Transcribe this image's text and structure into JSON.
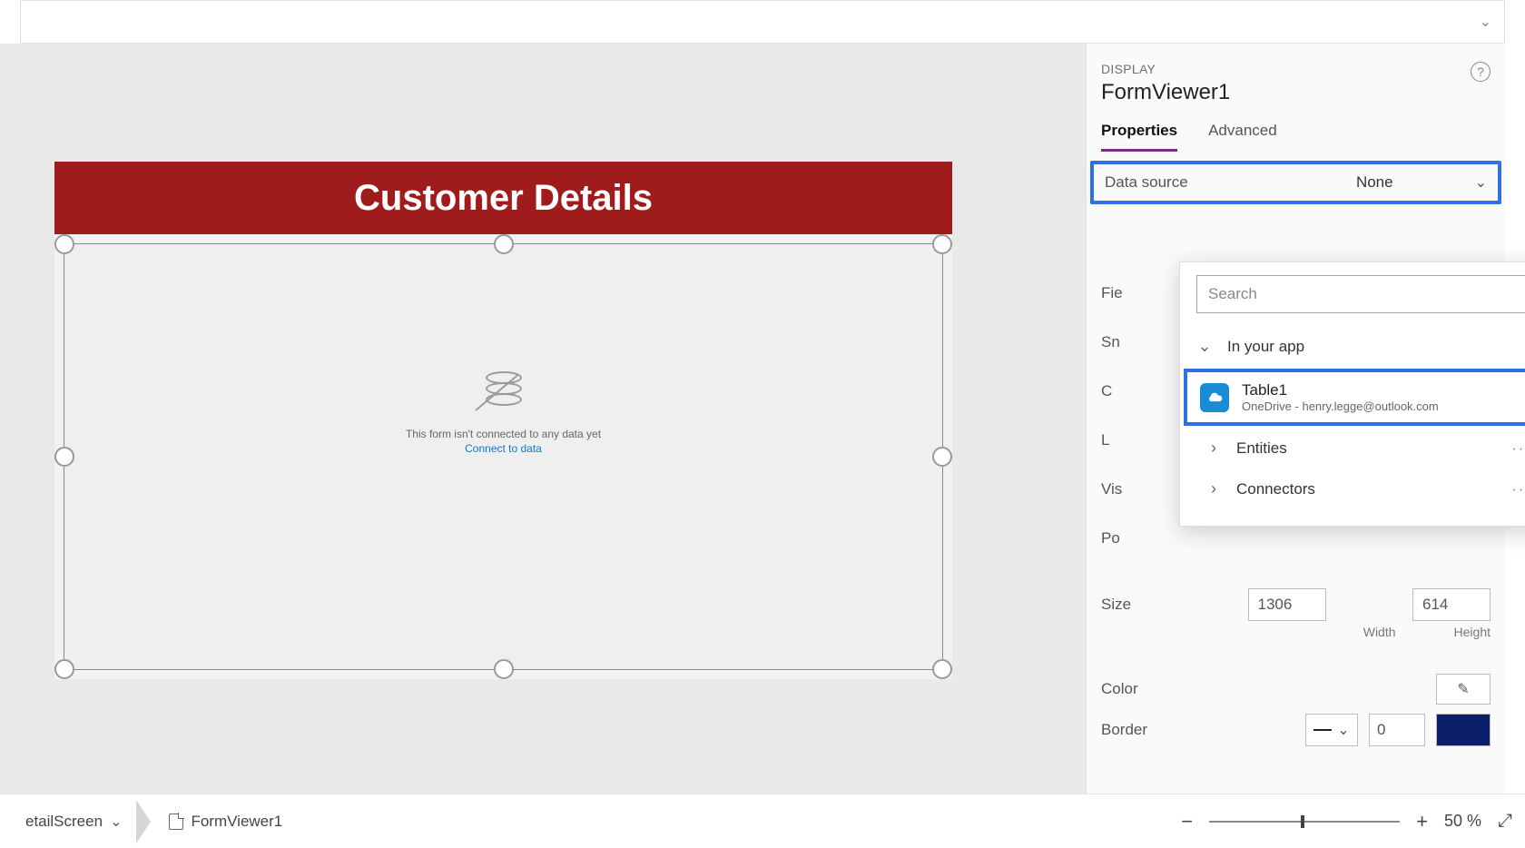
{
  "formula_bar": {},
  "canvas": {
    "header_title": "Customer Details",
    "empty_message": "This form isn't connected to any data yet",
    "connect_link": "Connect to data"
  },
  "panel": {
    "type_label": "DISPLAY",
    "control_name": "FormViewer1",
    "tabs": {
      "properties": "Properties",
      "advanced": "Advanced"
    },
    "datasource": {
      "label": "Data source",
      "value": "None"
    },
    "left_labels": {
      "fields": "Fie",
      "snap": "Sn",
      "c": "C",
      "l": "L",
      "vis": "Vis",
      "po": "Po"
    },
    "popover": {
      "search_placeholder": "Search",
      "in_your_app": "In your app",
      "table1": {
        "title": "Table1",
        "subtitle": "OneDrive - henry.legge@outlook.com"
      },
      "entities": "Entities",
      "connectors": "Connectors"
    },
    "size": {
      "label": "Size",
      "width": "1306",
      "height": "614",
      "width_label": "Width",
      "height_label": "Height"
    },
    "color": {
      "label": "Color"
    },
    "border": {
      "label": "Border",
      "value": "0",
      "color": "#0b1f6b"
    }
  },
  "status": {
    "screen": "etailScreen",
    "control": "FormViewer1",
    "zoom": "50  %"
  }
}
